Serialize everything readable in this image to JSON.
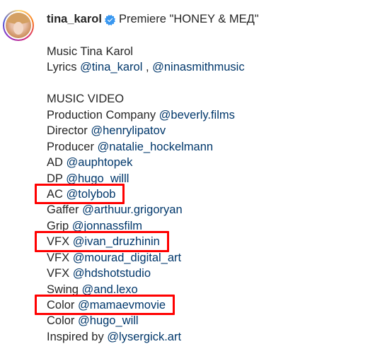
{
  "post": {
    "username": "tina_karol",
    "header_caption": "Premiere \"HONEY & МЕД\"",
    "verified_icon": "verified-badge-icon",
    "accent_colors": {
      "link": "#00376b",
      "verified": "#3897f0",
      "highlight": "#ff0000"
    }
  },
  "caption": {
    "lines": [
      {
        "prefix": "Music Tina Karol",
        "mentions": []
      },
      {
        "prefix": "Lyrics ",
        "mentions": [
          "@tina_karol",
          "@ninasmithmusic"
        ],
        "separator": " , "
      },
      {
        "blank": true
      },
      {
        "prefix": "MUSIC VIDEO",
        "mentions": []
      },
      {
        "prefix": "Production Company ",
        "mentions": [
          "@beverly.films"
        ]
      },
      {
        "prefix": "Director ",
        "mentions": [
          "@henrylipatov"
        ]
      },
      {
        "prefix": "Producer ",
        "mentions": [
          "@natalie_hockelmann"
        ]
      },
      {
        "prefix": "AD ",
        "mentions": [
          "@auphtopek"
        ]
      },
      {
        "prefix": "DP ",
        "mentions": [
          "@hugo_willl"
        ]
      },
      {
        "prefix": "AC ",
        "mentions": [
          "@tolybob"
        ],
        "highlighted": true
      },
      {
        "prefix": "Gaffer ",
        "mentions": [
          "@arthuur.grigoryan"
        ]
      },
      {
        "prefix": "Grip ",
        "mentions": [
          "@jonnassfilm"
        ]
      },
      {
        "prefix": "VFX ",
        "mentions": [
          "@ivan_druzhinin"
        ],
        "highlighted": true
      },
      {
        "prefix": "VFX ",
        "mentions": [
          "@mourad_digital_art"
        ]
      },
      {
        "prefix": "VFX ",
        "mentions": [
          "@hdshotstudio"
        ]
      },
      {
        "prefix": "Swing ",
        "mentions": [
          "@and.lexo"
        ]
      },
      {
        "prefix": "Color ",
        "mentions": [
          "@mamaevmovie"
        ],
        "highlighted": true
      },
      {
        "prefix": "Color ",
        "mentions": [
          "@hugo_will"
        ]
      },
      {
        "prefix": "Inspired by ",
        "mentions": [
          "@lysergick.art"
        ]
      }
    ]
  }
}
